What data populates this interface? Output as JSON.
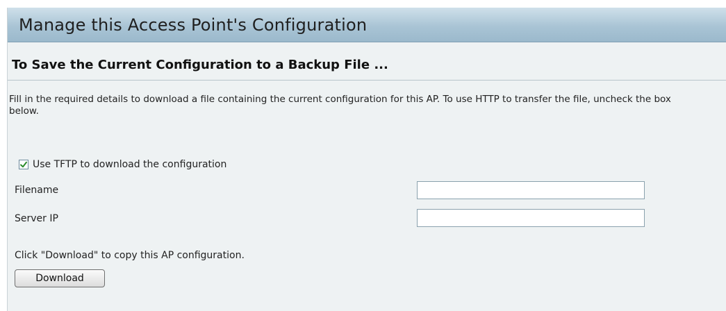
{
  "header": {
    "title": "Manage this Access Point's Configuration"
  },
  "section": {
    "title": "To Save the Current Configuration to a Backup File ...",
    "description": "Fill in the required details to download a file containing the current configuration for this AP. To use HTTP to transfer the file, uncheck the box below."
  },
  "form": {
    "use_tftp": {
      "label": "Use TFTP to download the configuration",
      "checked": true
    },
    "filename": {
      "label": "Filename",
      "value": ""
    },
    "server_ip": {
      "label": "Server IP",
      "value": ""
    },
    "hint": "Click \"Download\" to copy this AP configuration.",
    "download_label": "Download"
  },
  "colors": {
    "header_bg": "#a9c4d5",
    "panel_bg": "#eef2f3",
    "check_green": "#2a8a2a"
  },
  "icons": {
    "checkbox_mark": "checkmark-icon"
  }
}
